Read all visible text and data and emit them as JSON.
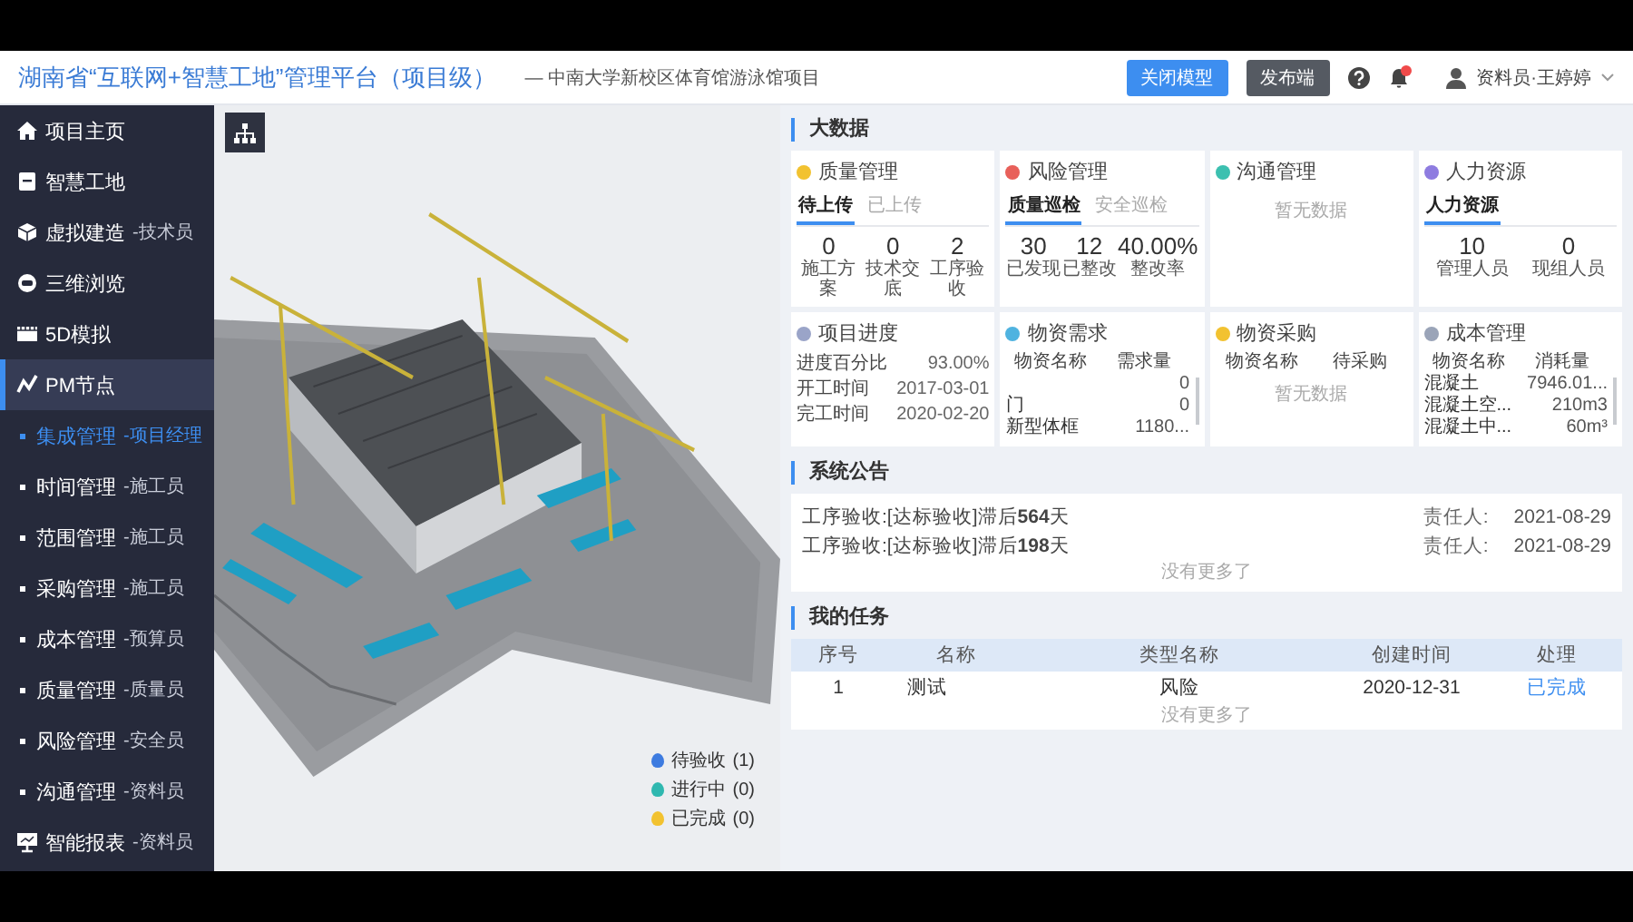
{
  "header": {
    "title": "湖南省“互联网+智慧工地”管理平台（项目级）",
    "subtitle": "— 中南大学新校区体育馆游泳馆项目",
    "buttons": [
      {
        "label": "关闭模型",
        "kind": "primary"
      },
      {
        "label": "发布端",
        "kind": "dark"
      }
    ],
    "user": "资料员·王婷婷"
  },
  "sidebar": {
    "items": [
      {
        "label": "项目主页",
        "selected": false
      },
      {
        "label": "智慧工地",
        "selected": false
      },
      {
        "label": "虚拟建造",
        "role": "-技术员",
        "selected": false
      },
      {
        "label": "三维浏览",
        "selected": false
      },
      {
        "label": "5D模拟",
        "selected": false
      },
      {
        "label": "PM节点",
        "selected": true,
        "children": [
          {
            "label": "集成管理",
            "role": "-项目经理",
            "selected": true
          },
          {
            "label": "时间管理",
            "role": "-施工员",
            "selected": false
          },
          {
            "label": "范围管理",
            "role": "-施工员",
            "selected": false
          },
          {
            "label": "采购管理",
            "role": "-施工员",
            "selected": false
          },
          {
            "label": "成本管理",
            "role": "-预算员",
            "selected": false
          },
          {
            "label": "质量管理",
            "role": "-质量员",
            "selected": false
          },
          {
            "label": "风险管理",
            "role": "-安全员",
            "selected": false
          },
          {
            "label": "沟通管理",
            "role": "-资料员",
            "selected": false
          }
        ]
      },
      {
        "label": "智能报表",
        "role": "-资料员",
        "selected": false
      }
    ]
  },
  "model": {
    "legend": [
      {
        "label": "待验收",
        "count": "(1)",
        "color": "#3d7be0"
      },
      {
        "label": "进行中",
        "count": "(0)",
        "color": "#2fb8b0"
      },
      {
        "label": "已完成",
        "count": "(0)",
        "color": "#f2c230"
      }
    ]
  },
  "big_data": {
    "title": "大数据",
    "cards": [
      {
        "kind": "stats",
        "title": "质量管理",
        "color": "#f2c230",
        "tabs": [
          {
            "label": "待上传",
            "selected": true
          },
          {
            "label": "已上传",
            "selected": false
          }
        ],
        "stats": [
          {
            "value": "0",
            "label": "施工方案"
          },
          {
            "value": "0",
            "label": "技术交底"
          },
          {
            "value": "2",
            "label": "工序验收"
          }
        ]
      },
      {
        "kind": "stats",
        "title": "风险管理",
        "color": "#e8605a",
        "tabs": [
          {
            "label": "质量巡检",
            "selected": true
          },
          {
            "label": "安全巡检",
            "selected": false
          }
        ],
        "stats": [
          {
            "value": "30",
            "label": "已发现"
          },
          {
            "value": "12",
            "label": "已整改"
          },
          {
            "value": "40.00%",
            "label": "整改率"
          }
        ]
      },
      {
        "kind": "empty",
        "title": "沟通管理",
        "color": "#3cc0b0",
        "message": "暂无数据"
      },
      {
        "kind": "stats",
        "title": "人力资源",
        "color": "#8e7ce0",
        "tabs": [
          {
            "label": "人力资源",
            "selected": true
          }
        ],
        "stats": [
          {
            "value": "10",
            "label": "管理人员"
          },
          {
            "value": "0",
            "label": "现组人员"
          }
        ]
      },
      {
        "kind": "fields",
        "title": "项目进度",
        "color": "#9aa4c8",
        "fields": [
          {
            "label": "进度百分比",
            "value": "93.00%"
          },
          {
            "label": "开工时间",
            "value": "2017-03-01"
          },
          {
            "label": "完工时间",
            "value": "2020-02-20"
          }
        ]
      },
      {
        "kind": "table",
        "title": "物资需求",
        "color": "#4fb3e0",
        "columns": [
          "物资名称",
          "需求量"
        ],
        "rows": [
          {
            "amount": "0"
          },
          {
            "name": "门",
            "amount": "0"
          },
          {
            "name": "新型体框",
            "amount": "1180..."
          }
        ]
      },
      {
        "kind": "table",
        "title": "物资采购",
        "color": "#f2c230",
        "columns": [
          "物资名称",
          "待采购"
        ],
        "message": "暂无数据"
      },
      {
        "kind": "table",
        "title": "成本管理",
        "color": "#9aa4b8",
        "columns": [
          "物资名称",
          "消耗量"
        ],
        "rows": [
          {
            "name": "混凝土",
            "amount": "7946.01..."
          },
          {
            "name": "混凝土空...",
            "amount": "210m3"
          },
          {
            "name": "混凝土中...",
            "amount": "60m³"
          }
        ]
      }
    ]
  },
  "notices": {
    "title": "系统公告",
    "items": [
      {
        "text": "工序验收:[达标验收]滞后**564**天",
        "owner_label": "责任人:",
        "date": "2021-08-29"
      },
      {
        "text": "工序验收:[达标验收]滞后**198**天",
        "owner_label": "责任人:",
        "date": "2021-08-29"
      }
    ],
    "footer": "没有更多了"
  },
  "tasks": {
    "title": "我的任务",
    "columns": [
      "序号",
      "名称",
      "类型名称",
      "创建时间",
      "处理"
    ],
    "rows": [
      {
        "cells": [
          "1",
          "测试",
          "风险",
          "2020-12-31"
        ],
        "action": "已完成"
      }
    ],
    "footer": "没有更多了"
  }
}
